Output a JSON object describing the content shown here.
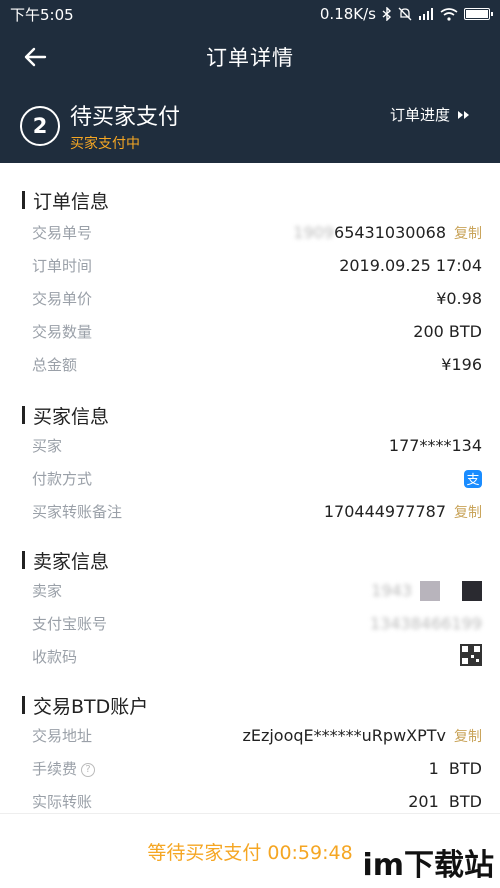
{
  "status_bar": {
    "time": "下午5:05",
    "network_speed": "0.18K/s"
  },
  "nav": {
    "title": "订单详情"
  },
  "order_status": {
    "step": "2",
    "title": "待买家支付",
    "subtitle": "买家支付中",
    "progress_link": "订单进度"
  },
  "order_info": {
    "title": "订单信息",
    "rows": [
      {
        "label": "交易单号",
        "value_blurred": "1909",
        "value": "65431030068",
        "copy": "复制"
      },
      {
        "label": "订单时间",
        "value": "2019.09.25 17:04"
      },
      {
        "label": "交易单价",
        "value": "¥0.98"
      },
      {
        "label": "交易数量",
        "value": "200 BTD"
      },
      {
        "label": "总金额",
        "value": "¥196"
      }
    ]
  },
  "buyer_info": {
    "title": "买家信息",
    "rows": [
      {
        "label": "买家",
        "value": "177****134"
      },
      {
        "label": "付款方式",
        "value": "支"
      },
      {
        "label": "买家转账备注",
        "value": "170444977787",
        "copy": "复制"
      }
    ]
  },
  "seller_info": {
    "title": "卖家信息",
    "rows": [
      {
        "label": "卖家",
        "value_blurred": "1943"
      },
      {
        "label": "支付宝账号",
        "value_blurred": "13438466199"
      },
      {
        "label": "收款码"
      }
    ]
  },
  "btd_account": {
    "title": "交易BTD账户",
    "rows": [
      {
        "label": "交易地址",
        "value": "zEzjooqE******uRpwXPTv",
        "copy": "复制"
      },
      {
        "label": "手续费",
        "help": "?",
        "value": "1  BTD"
      },
      {
        "label": "实际转账",
        "value": "201  BTD"
      }
    ]
  },
  "footer": {
    "text": "等待买家支付 00:59:48"
  },
  "watermark": "im下载站",
  "colors": {
    "header_bg": "#1f2d3d",
    "accent": "#f5a623",
    "copy": "#c9a45a"
  },
  "status_icons": [
    "bluetooth-icon",
    "mute-icon",
    "signal-icon",
    "wifi-icon",
    "battery-icon"
  ]
}
